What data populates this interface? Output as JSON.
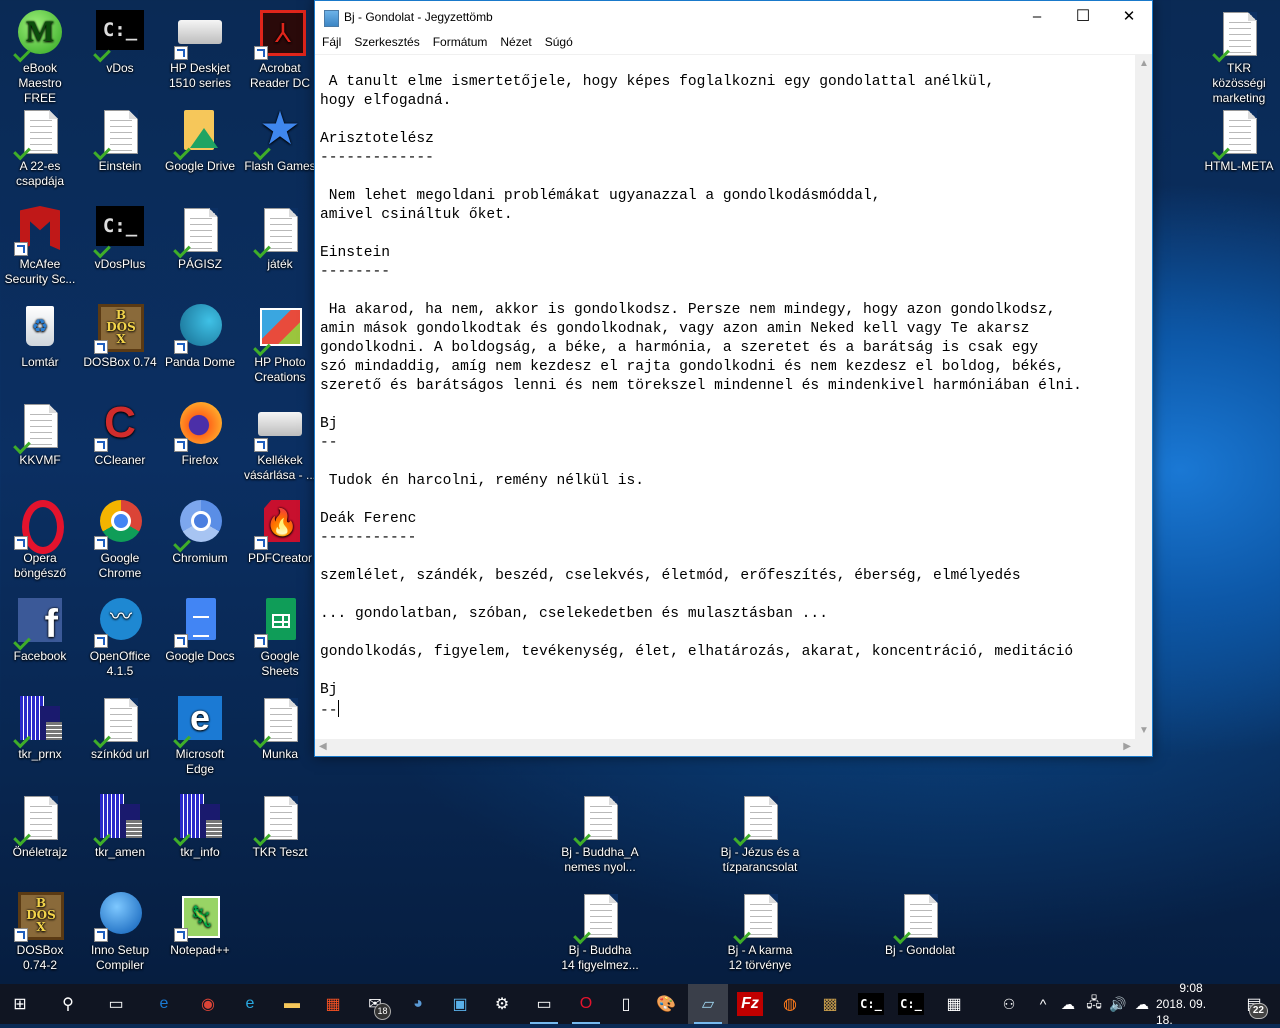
{
  "desktop": {
    "icons_left": [
      {
        "label": "eBook\nMaestro FREE",
        "icon": "ebook-maestro-icon",
        "badge": "check"
      },
      {
        "label": "vDos",
        "icon": "vdos-icon",
        "badge": "check"
      },
      {
        "label": "HP Deskjet\n1510 series",
        "icon": "printer-icon",
        "badge": "shortcut"
      },
      {
        "label": "Acrobat\nReader DC",
        "icon": "acrobat-icon",
        "badge": "shortcut"
      },
      {
        "label": "A 22-es\ncsapdája",
        "icon": "text-document-icon",
        "badge": "check"
      },
      {
        "label": "Einstein",
        "icon": "text-document-icon",
        "badge": "check"
      },
      {
        "label": "Google Drive",
        "icon": "google-drive-icon",
        "badge": "check"
      },
      {
        "label": "Flash Games",
        "icon": "star-icon",
        "badge": "check"
      },
      {
        "label": "McAfee\nSecurity Sc...",
        "icon": "mcafee-icon",
        "badge": "shortcut"
      },
      {
        "label": "vDosPlus",
        "icon": "vdos-icon",
        "badge": "check"
      },
      {
        "label": "PÁGISZ",
        "icon": "text-document-icon",
        "badge": "check"
      },
      {
        "label": "játék",
        "icon": "text-document-icon",
        "badge": "check"
      },
      {
        "label": "Lomtár",
        "icon": "recycle-bin-icon",
        "badge": "none"
      },
      {
        "label": "DOSBox 0.74",
        "icon": "dosbox-icon",
        "badge": "shortcut"
      },
      {
        "label": "Panda Dome",
        "icon": "panda-dome-icon",
        "badge": "shortcut"
      },
      {
        "label": "HP Photo\nCreations",
        "icon": "photo-creations-icon",
        "badge": "check"
      },
      {
        "label": "KKVMF",
        "icon": "text-document-icon",
        "badge": "check"
      },
      {
        "label": "CCleaner",
        "icon": "ccleaner-icon",
        "badge": "shortcut"
      },
      {
        "label": "Firefox",
        "icon": "firefox-icon",
        "badge": "shortcut"
      },
      {
        "label": "Kellékek\nvásárlása - ...",
        "icon": "printer-icon",
        "badge": "shortcut"
      },
      {
        "label": "Opera\nböngésző",
        "icon": "opera-icon",
        "badge": "shortcut"
      },
      {
        "label": "Google\nChrome",
        "icon": "chrome-icon",
        "badge": "shortcut"
      },
      {
        "label": "Chromium",
        "icon": "chromium-icon",
        "badge": "check"
      },
      {
        "label": "PDFCreator",
        "icon": "pdfcreator-icon",
        "badge": "shortcut"
      },
      {
        "label": "Facebook",
        "icon": "facebook-icon",
        "badge": "check"
      },
      {
        "label": "OpenOffice\n4.1.5",
        "icon": "openoffice-icon",
        "badge": "shortcut"
      },
      {
        "label": "Google Docs",
        "icon": "google-docs-icon",
        "badge": "shortcut"
      },
      {
        "label": "Google Sheets",
        "icon": "google-sheets-icon",
        "badge": "shortcut"
      },
      {
        "label": "tkr_prnx",
        "icon": "building-icon",
        "badge": "check"
      },
      {
        "label": "színkód url",
        "icon": "text-document-icon",
        "badge": "check"
      },
      {
        "label": "Microsoft\nEdge",
        "icon": "edge-icon",
        "badge": "check"
      },
      {
        "label": "Munka",
        "icon": "text-document-icon",
        "badge": "check"
      },
      {
        "label": "Önéletrajz",
        "icon": "text-document-icon",
        "badge": "check"
      },
      {
        "label": "tkr_amen",
        "icon": "building-icon",
        "badge": "check"
      },
      {
        "label": "tkr_info",
        "icon": "building-icon",
        "badge": "check"
      },
      {
        "label": "TKR Teszt",
        "icon": "text-document-icon",
        "badge": "check"
      },
      {
        "label": "DOSBox\n0.74-2",
        "icon": "dosbox-icon",
        "badge": "shortcut"
      },
      {
        "label": "Inno Setup\nCompiler",
        "icon": "inno-setup-icon",
        "badge": "shortcut"
      },
      {
        "label": "Notepad++",
        "icon": "notepadpp-icon",
        "badge": "shortcut"
      }
    ],
    "icons_right": [
      {
        "label": "TKR közösségi\nmarketing",
        "icon": "text-document-icon",
        "badge": "check"
      },
      {
        "label": "HTML-META",
        "icon": "text-document-icon",
        "badge": "check"
      }
    ],
    "icons_bottom": [
      {
        "label": "Bj - Buddha_A\nnemes nyol...",
        "icon": "text-document-icon",
        "badge": "check"
      },
      {
        "label": "Bj - Jézus és a\ntízparancsolat",
        "icon": "text-document-icon",
        "badge": "check"
      },
      {
        "label": "Bj - Buddha\n14 figyelmez...",
        "icon": "text-document-icon",
        "badge": "check"
      },
      {
        "label": "Bj - A karma\n12 törvénye",
        "icon": "text-document-icon",
        "badge": "check"
      },
      {
        "label": "Bj - Gondolat",
        "icon": "text-document-icon",
        "badge": "check"
      }
    ]
  },
  "notepad": {
    "title": "Bj - Gondolat - Jegyzettömb",
    "controls": {
      "minimize": "–",
      "maximize": "☐",
      "close": "✕"
    },
    "menu": [
      "Fájl",
      "Szerkesztés",
      "Formátum",
      "Nézet",
      "Súgó"
    ],
    "lines": [
      " A tanult elme ismertetőjele, hogy képes foglalkozni egy gondolattal anélkül,",
      "hogy elfogadná.",
      "",
      "Arisztotelész",
      "-------------",
      "",
      " Nem lehet megoldani problémákat ugyanazzal a gondolkodásmóddal,",
      "amivel csináltuk őket.",
      "",
      "Einstein",
      "--------",
      "",
      " Ha akarod, ha nem, akkor is gondolkodsz. Persze nem mindegy, hogy azon gondolkodsz,",
      "amin mások gondolkodtak és gondolkodnak, vagy azon amin Neked kell vagy Te akarsz",
      "gondolkodni. A boldogság, a béke, a harmónia, a szeretet és a barátság is csak egy",
      "szó mindaddig, amíg nem kezdesz el rajta gondolkodni és nem kezdesz el boldog, békés,",
      "szerető és barátságos lenni és nem törekszel mindennel és mindenkivel harmóniában élni.",
      "",
      "Bj",
      "--",
      "",
      " Tudok én harcolni, remény nélkül is.",
      "",
      "Deák Ferenc",
      "-----------",
      "",
      "szemlélet, szándék, beszéd, cselekvés, életmód, erőfeszítés, éberség, elmélyedés",
      "",
      "... gondolatban, szóban, cselekedetben és mulasztásban ...",
      "",
      "gondolkodás, figyelem, tevékenység, élet, elhatározás, akarat, koncentráció, meditáció",
      "",
      "Bj",
      "--"
    ]
  },
  "taskbar": {
    "items": [
      {
        "name": "start-button",
        "glyph": "⊞"
      },
      {
        "name": "search-button",
        "glyph": "⚲"
      },
      {
        "name": "task-view-button",
        "glyph": "▭"
      },
      {
        "name": "edge-taskbar-icon",
        "glyph": "e"
      },
      {
        "name": "chrome-taskbar-icon",
        "glyph": "◉"
      },
      {
        "name": "ie-taskbar-icon",
        "glyph": "e"
      },
      {
        "name": "file-explorer-taskbar-icon",
        "glyph": "▬"
      },
      {
        "name": "store-taskbar-icon",
        "glyph": "▦"
      },
      {
        "name": "mail-taskbar-icon",
        "glyph": "✉"
      },
      {
        "name": "thunderbird-taskbar-icon",
        "glyph": "◕"
      },
      {
        "name": "control-panel-taskbar-icon",
        "glyph": "▣"
      },
      {
        "name": "settings-taskbar-icon",
        "glyph": "⚙"
      },
      {
        "name": "cmd-taskbar-icon",
        "glyph": "▭"
      },
      {
        "name": "opera-taskbar-icon",
        "glyph": "O"
      },
      {
        "name": "blank-document-taskbar-icon",
        "glyph": "▯"
      },
      {
        "name": "paint-taskbar-icon",
        "glyph": "🎨"
      },
      {
        "name": "notepad-taskbar-icon",
        "glyph": "▱"
      },
      {
        "name": "filezilla-taskbar-icon",
        "glyph": "Fz"
      },
      {
        "name": "firefox-taskbar-icon",
        "glyph": "◍"
      },
      {
        "name": "dosbox-taskbar-icon",
        "glyph": "▩"
      },
      {
        "name": "vdos-taskbar-icon",
        "glyph": "C:_"
      },
      {
        "name": "vdosplus-taskbar-icon",
        "glyph": "C:_"
      },
      {
        "name": "calculator-taskbar-icon",
        "glyph": "▦"
      }
    ],
    "mail_badge": "18",
    "tray": {
      "people": "⚇",
      "chevron": "^",
      "onedrive": "☁",
      "network": "🖧",
      "volume": "🔊",
      "cloud_upload": "☁",
      "time": "9:08",
      "date": "2018. 09. 18.",
      "notifications_count": "22"
    }
  }
}
